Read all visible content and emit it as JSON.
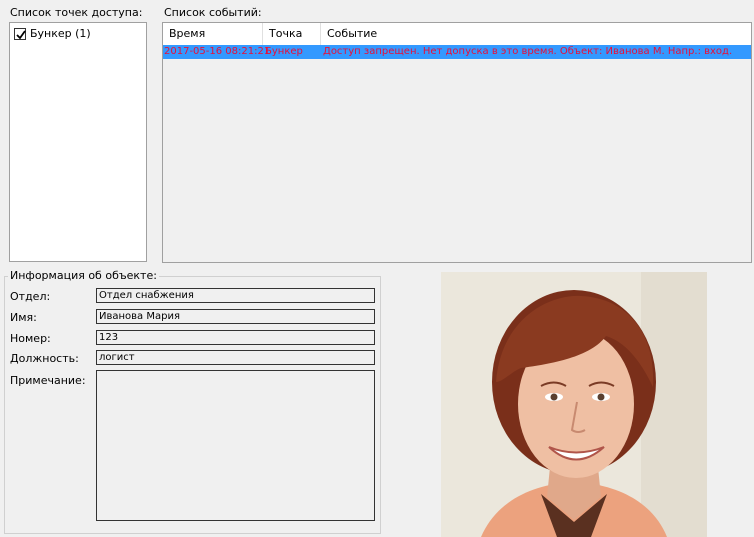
{
  "access_points": {
    "title": "Список точек доступа:",
    "items": [
      {
        "label": "Бункер (1)",
        "checked": true
      }
    ]
  },
  "events": {
    "title": "Список событий:",
    "columns": [
      "Время",
      "Точка",
      "Событие"
    ],
    "rows": [
      {
        "time": "2017-05-16 08:21:21",
        "point": "Бункер",
        "event": "Доступ запрещен. Нет допуска в это время. Объект: Иванова М.  Напр.: вход."
      }
    ]
  },
  "object_info": {
    "title": "Информация об объекте:",
    "department_label": "Отдел:",
    "department_value": "Отдел снабжения",
    "name_label": "Имя:",
    "name_value": "Иванова Мария",
    "number_label": "Номер:",
    "number_value": "123",
    "position_label": "Должность:",
    "position_value": "логист",
    "note_label": "Примечание:",
    "note_value": ""
  },
  "colors": {
    "selection": "#3399ff",
    "event_text": "#e8103a"
  }
}
